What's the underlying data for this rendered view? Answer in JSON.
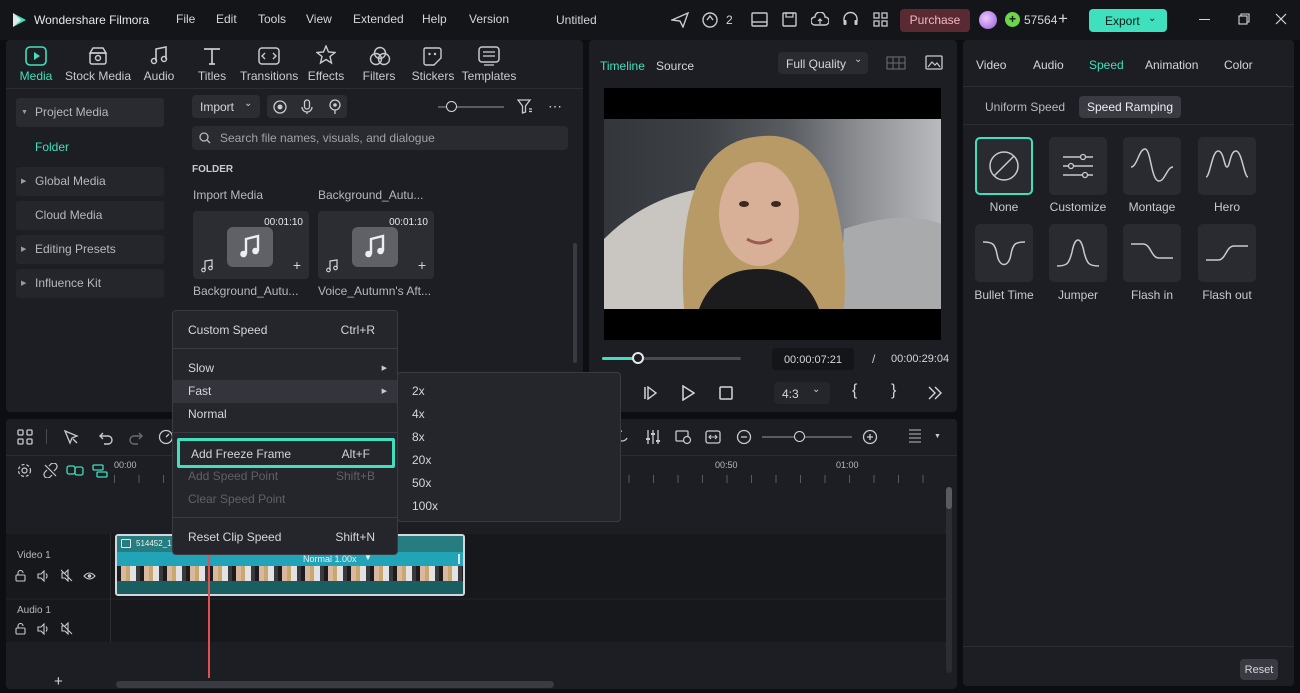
{
  "app": {
    "name": "Wondershare Filmora",
    "project_title": "Untitled",
    "menu": [
      "File",
      "Edit",
      "Tools",
      "View",
      "Extended",
      "Help",
      "Version"
    ],
    "notifications": "2",
    "purchase_label": "Purchase",
    "credits": "57564",
    "export_label": "Export"
  },
  "colors": {
    "accent": "#3ee0bd",
    "purchase": "#5a2a33",
    "export": "#3ee0bd",
    "playhead": "#e05050"
  },
  "media_tabs": [
    {
      "label": "Media",
      "icon": "media-icon",
      "active": true
    },
    {
      "label": "Stock Media",
      "icon": "stock-media-icon"
    },
    {
      "label": "Audio",
      "icon": "music-note-icon"
    },
    {
      "label": "Titles",
      "icon": "text-t-icon"
    },
    {
      "label": "Transitions",
      "icon": "transitions-icon"
    },
    {
      "label": "Effects",
      "icon": "effects-icon"
    },
    {
      "label": "Filters",
      "icon": "filters-icon"
    },
    {
      "label": "Stickers",
      "icon": "stickers-icon"
    },
    {
      "label": "Templates",
      "icon": "templates-icon"
    }
  ],
  "sidebar": {
    "project_media": "Project Media",
    "folder": "Folder",
    "global_media": "Global Media",
    "cloud_media": "Cloud Media",
    "editing_presets": "Editing Presets",
    "influence_kit": "Influence Kit"
  },
  "library": {
    "import_label": "Import",
    "search_placeholder": "Search file names, visuals, and dialogue",
    "folder_heading": "FOLDER",
    "items": [
      {
        "top_label": "Import Media",
        "duration": "00:01:10",
        "name": "Background_Autu..."
      },
      {
        "top_label": "Background_Autu...",
        "duration": "00:01:10",
        "name": "Voice_Autumn's Aft..."
      }
    ]
  },
  "preview": {
    "tabs": [
      "Timeline",
      "Source"
    ],
    "quality": "Full Quality",
    "current_time": "00:00:07:21",
    "separator": "/",
    "total_time": "00:00:29:04",
    "aspect": "4:3",
    "progress": 0.26
  },
  "context_menu": {
    "items": [
      {
        "label": "Custom Speed",
        "shortcut": "Ctrl+R"
      },
      {
        "label": "Slow",
        "submenu": true
      },
      {
        "label": "Fast",
        "submenu": true
      },
      {
        "label": "Normal"
      },
      {
        "label": "Add Freeze Frame",
        "shortcut": "Alt+F"
      },
      {
        "label": "Add Speed Point",
        "shortcut": "Shift+B",
        "disabled": true
      },
      {
        "label": "Clear Speed Point",
        "disabled": true
      },
      {
        "label": "Reset Clip Speed",
        "shortcut": "Shift+N"
      }
    ],
    "fast_submenu": [
      "2x",
      "4x",
      "8x",
      "20x",
      "50x",
      "100x"
    ]
  },
  "timeline": {
    "ruler": [
      "00:00",
      "00:50",
      "01:00"
    ],
    "tracks": {
      "video": "Video 1",
      "audio": "Audio 1"
    },
    "clip_name": "514452_1",
    "clip_speed": "Normal 1.00x"
  },
  "right_panel": {
    "tabs": [
      "Video",
      "Audio",
      "Speed",
      "Animation",
      "Color"
    ],
    "active_tab": "Speed",
    "subtabs": [
      "Uniform Speed",
      "Speed Ramping"
    ],
    "presets": [
      "None",
      "Customize",
      "Montage",
      "Hero",
      "Bullet Time",
      "Jumper",
      "Flash in",
      "Flash out"
    ],
    "reset_label": "Reset"
  }
}
